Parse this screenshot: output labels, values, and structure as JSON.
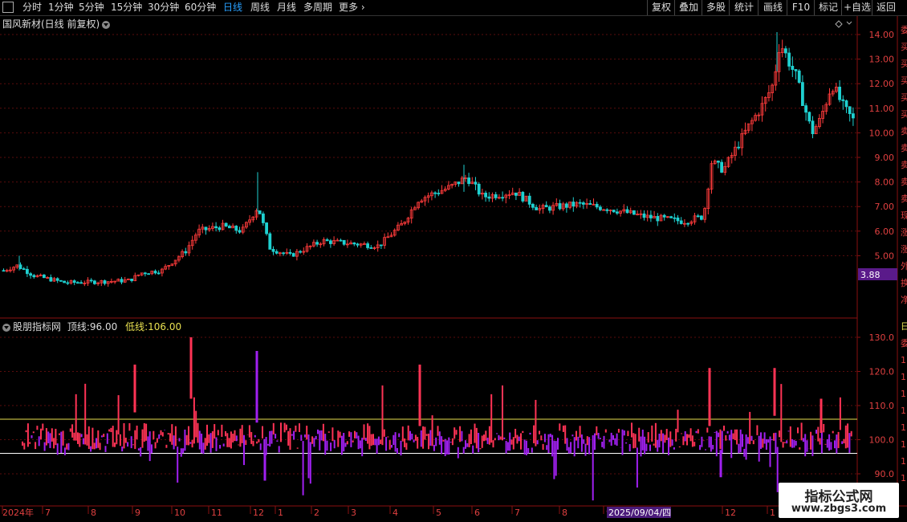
{
  "toolbar": {
    "periods": [
      "分时",
      "1分钟",
      "5分钟",
      "15分钟",
      "30分钟",
      "60分钟",
      "日线",
      "周线",
      "月线",
      "多周期",
      "更多"
    ],
    "active_period": "日线",
    "right_buttons": [
      "复权",
      "叠加",
      "多股",
      "统计",
      "画线",
      "F10",
      "标记",
      "+自选",
      "返回"
    ]
  },
  "main_chart": {
    "title": "国风新材(日线 前复权)",
    "price_axis": [
      "14.00",
      "13.00",
      "12.00",
      "11.00",
      "10.00",
      "9.00",
      "8.00",
      "7.00",
      "6.00",
      "5.00"
    ],
    "current_price_tag": "3.88",
    "side_chars": [
      "委",
      "买",
      "买",
      "买",
      "买",
      "买",
      "卖",
      "卖",
      "卖",
      "卖",
      "卖",
      "现",
      "涨",
      "涨",
      "外",
      "换",
      "净"
    ]
  },
  "indicator": {
    "name": "股朋指标网",
    "top_label": "顶线:",
    "top_value": "96.00",
    "low_label": "低线:",
    "low_value": "106.00",
    "axis": [
      "130.0",
      "120.0",
      "110.0",
      "100.0",
      "90.0"
    ],
    "side_chars": [
      "日",
      "委",
      "1",
      "1",
      "1",
      "1",
      "1",
      "1",
      "1",
      "1"
    ]
  },
  "date_axis": {
    "labels": [
      "2024年",
      "7",
      "8",
      "9",
      "10",
      "11",
      "12",
      "1",
      "2",
      "3",
      "4",
      "5",
      "6",
      "7",
      "8",
      "9",
      "12",
      "1"
    ],
    "cursor_date": "2025/09/04/四"
  },
  "watermark": {
    "line1": "指标公式网",
    "line2": "www.zbgs3.com"
  },
  "colors": {
    "up": "#ff3b3b",
    "down": "#1fd0d0",
    "grid": "#5a0c0c",
    "top_line": "#ffffff",
    "low_line": "#e8e050",
    "indicator_high": "#ff3355",
    "indicator_low": "#a020f0",
    "active_tab": "#28a0ff",
    "price_tag": "#5a1a8a"
  }
}
